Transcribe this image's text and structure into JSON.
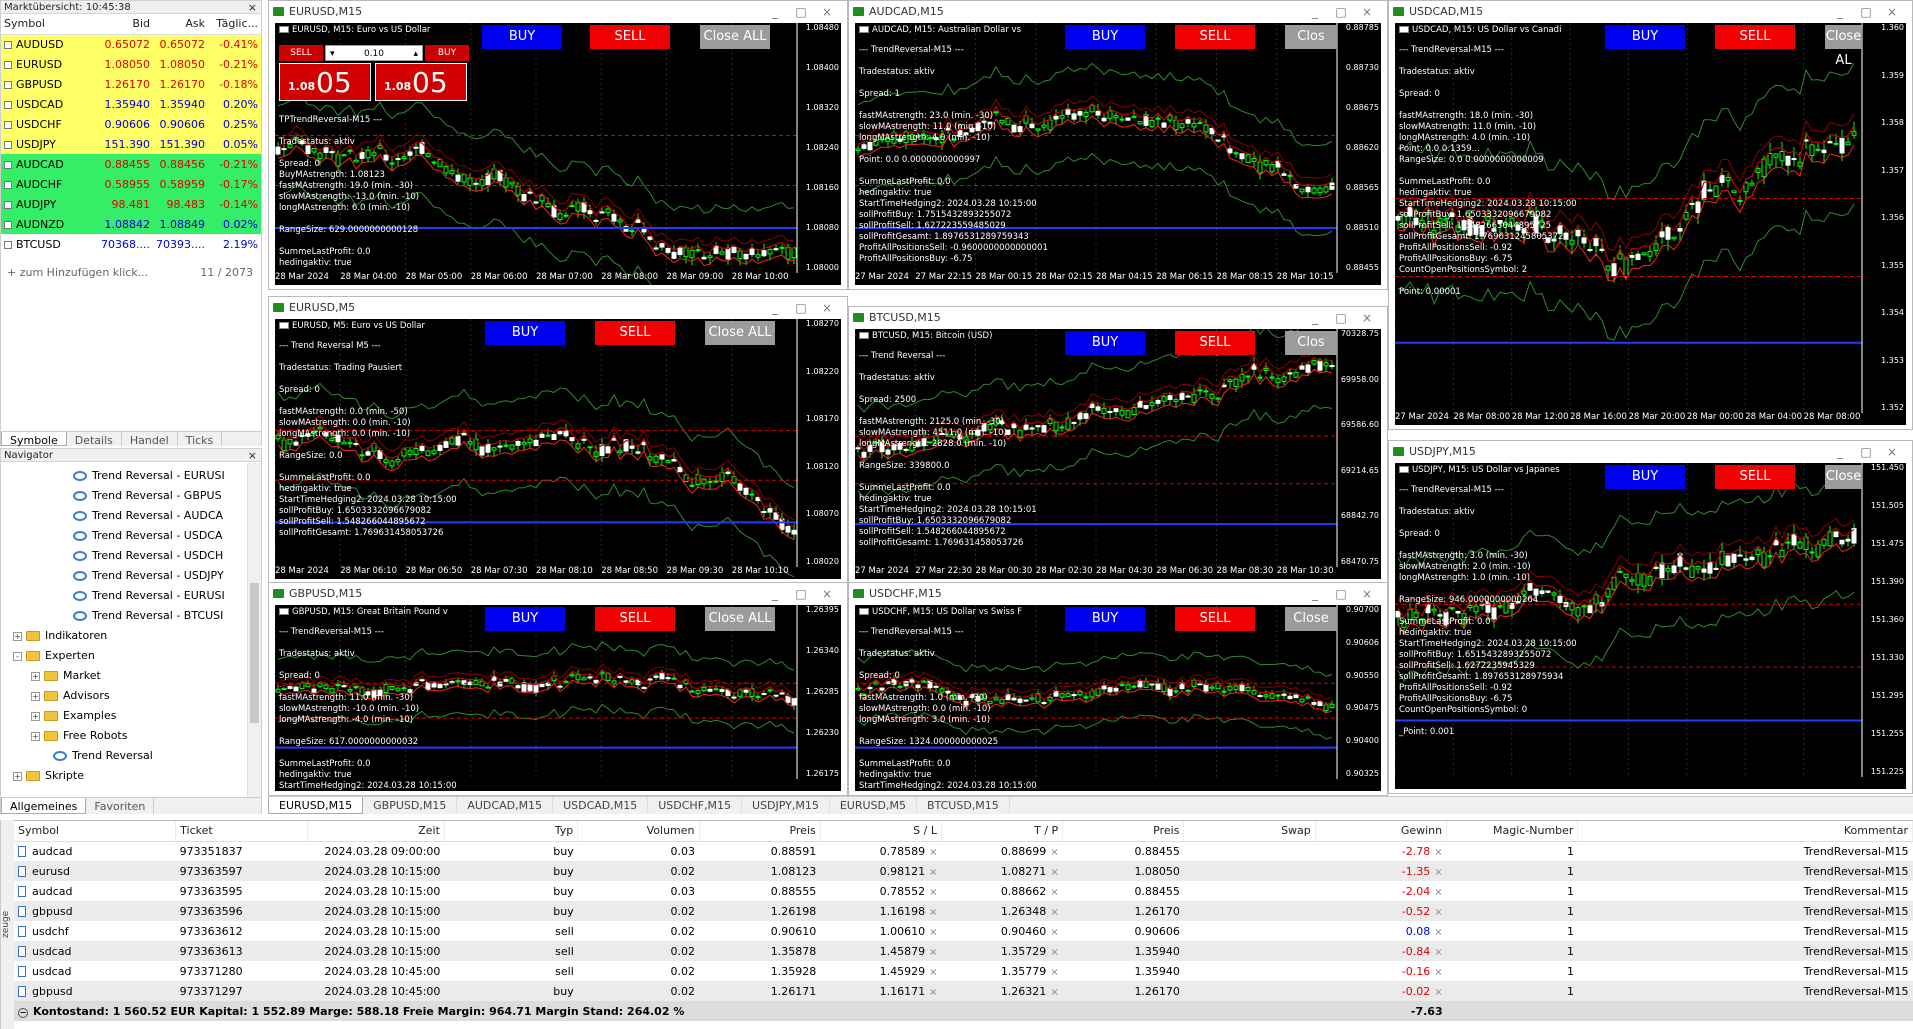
{
  "market_watch": {
    "title": "Marktübersicht: 10:45:38",
    "headers": {
      "symbol": "Symbol",
      "bid": "Bid",
      "ask": "Ask",
      "daily": "Täglic..."
    },
    "rows": [
      {
        "symbol": "AUDUSD",
        "bid": "0.65072",
        "ask": "0.65072",
        "change": "-0.41%",
        "color": "#ffff66",
        "change_color": "#e00000"
      },
      {
        "symbol": "EURUSD",
        "bid": "1.08050",
        "ask": "1.08050",
        "change": "-0.21%",
        "color": "#ffff66",
        "change_color": "#e00000"
      },
      {
        "symbol": "GBPUSD",
        "bid": "1.26170",
        "ask": "1.26170",
        "change": "-0.18%",
        "color": "#ffff66",
        "change_color": "#e00000"
      },
      {
        "symbol": "USDCAD",
        "bid": "1.35940",
        "ask": "1.35940",
        "change": "0.20%",
        "color": "#ffff66",
        "change_color": "#0000d0"
      },
      {
        "symbol": "USDCHF",
        "bid": "0.90606",
        "ask": "0.90606",
        "change": "0.25%",
        "color": "#ffff66",
        "change_color": "#0000d0"
      },
      {
        "symbol": "USDJPY",
        "bid": "151.390",
        "ask": "151.390",
        "change": "0.05%",
        "color": "#ffff66",
        "change_color": "#0000d0"
      },
      {
        "symbol": "AUDCAD",
        "bid": "0.88455",
        "ask": "0.88456",
        "change": "-0.21%",
        "color": "#33ee66",
        "change_color": "#e00000"
      },
      {
        "symbol": "AUDCHF",
        "bid": "0.58955",
        "ask": "0.58959",
        "change": "-0.17%",
        "color": "#33ee66",
        "change_color": "#e00000"
      },
      {
        "symbol": "AUDJPY",
        "bid": "98.481",
        "ask": "98.483",
        "change": "-0.14%",
        "color": "#33ee66",
        "change_color": "#e00000"
      },
      {
        "symbol": "AUDNZD",
        "bid": "1.08842",
        "ask": "1.08849",
        "change": "0.02%",
        "color": "#33ee66",
        "change_color": "#0000d0"
      },
      {
        "symbol": "BTCUSD",
        "bid": "70368....",
        "ask": "70393....",
        "change": "2.19%",
        "color": "#ffffff",
        "change_color": "#0000d0"
      }
    ],
    "add_label": "zum Hinzufügen klick...",
    "count": "11 / 2073",
    "tabs": [
      "Symbole",
      "Details",
      "Handel",
      "Ticks"
    ]
  },
  "navigator": {
    "title": "Navigator",
    "items": [
      {
        "label": "Trend Reversal - EURUSI",
        "type": "ea",
        "indent": 72
      },
      {
        "label": "Trend Reversal - GBPUS",
        "type": "ea",
        "indent": 72
      },
      {
        "label": "Trend Reversal - AUDCA",
        "type": "ea",
        "indent": 72
      },
      {
        "label": "Trend Reversal - USDCA",
        "type": "ea",
        "indent": 72
      },
      {
        "label": "Trend Reversal - USDCH",
        "type": "ea",
        "indent": 72
      },
      {
        "label": "Trend Reversal - USDJPY",
        "type": "ea",
        "indent": 72
      },
      {
        "label": "Trend Reversal - EURUSI",
        "type": "ea",
        "indent": 72
      },
      {
        "label": "Trend Reversal - BTCUSI",
        "type": "ea",
        "indent": 72
      },
      {
        "label": "Indikatoren",
        "type": "folder",
        "indent": 12,
        "expander": "+"
      },
      {
        "label": "Experten",
        "type": "folder",
        "indent": 12,
        "expander": "-"
      },
      {
        "label": "Market",
        "type": "folder",
        "indent": 30,
        "expander": "+"
      },
      {
        "label": "Advisors",
        "type": "folder",
        "indent": 30,
        "expander": "+"
      },
      {
        "label": "Examples",
        "type": "folder",
        "indent": 30,
        "expander": "+"
      },
      {
        "label": "Free Robots",
        "type": "folder",
        "indent": 30,
        "expander": "+"
      },
      {
        "label": "Trend Reversal",
        "type": "ea",
        "indent": 52
      },
      {
        "label": "Skripte",
        "type": "folder",
        "indent": 12,
        "expander": "+"
      }
    ],
    "tabs": [
      "Allgemeines",
      "Favoriten"
    ]
  },
  "charts": [
    {
      "id": "c1",
      "title": "EURUSD,M15",
      "info": "EURUSD, M15:  Euro vs US Dollar",
      "x": 268,
      "y": 0,
      "w": 580,
      "h": 290,
      "oneclick": true,
      "sell_price": "1.08",
      "sell_big": "05",
      "buy_price": "1.08",
      "buy_big": "05",
      "lot": "0.10",
      "sell_lbl": "SELL",
      "buy_lbl": "BUY",
      "btn_buy": "BUY",
      "btn_sell": "SELL",
      "btn_close": "Close ALL",
      "btnx": [
        475,
        583,
        693
      ],
      "text": "TPTrendReversal-M15 ---\n\nTradestatus: aktiv\n\nSpread: 0\nBuyMAstrength: 1.08123\nfastMAstrength: 19.0 (min. -30)\nslowMAstrength: -13.0 (min. -10)\nlongMAstrength: 6.0 (min. -10)\n\nRangeSize: 629.0000000000128\n\nSummeLastProfit: 0.0\nhedingaktiv: true",
      "yticks": [
        "1.08480",
        "1.08400",
        "1.08320",
        "1.08240",
        "1.08160",
        "1.08080",
        "1.08000"
      ],
      "xticks": [
        "28 Mar 2024",
        "28 Mar 04:00",
        "28 Mar 05:00",
        "28 Mar 06:00",
        "28 Mar 07:00",
        "28 Mar 08:00",
        "28 Mar 09:00",
        "28 Mar 10:00"
      ],
      "seed": 3,
      "trend": "down"
    },
    {
      "id": "c2",
      "title": "AUDCAD,M15",
      "info": "AUDCAD, M15:  Australian Dollar vs",
      "x": 848,
      "y": 0,
      "w": 540,
      "h": 290,
      "oneclick": false,
      "btn_buy": "BUY",
      "btn_sell": "SELL",
      "btn_close": "Clos",
      "btnx": [
        210,
        320,
        430
      ],
      "text": "--- TrendReversal-M15 ---\n\nTradestatus: aktiv\n\nSpread: 1\n\nfastMAstrength: 23.0 (min. -30)\nslowMAstrength: 11.0 (min. -10)\nlongMAstrength: 4.0 (min. -10)\n\nPoint: 0.0 0.0000000000997\n\nSummeLastProfit: 0.0\nhedingaktiv: true\nStartTimeHedging2: 2024.03.28 10:15:00\nsollProfitBuy: 1.7515432893255072\nsollProfitSell: 1.627223559485029\nsollProfitGesamt: 1.8976531289759343\nProfitAllPositionsSell: -0.9600000000000001\nProfitAllPositionsBuy: -6.75",
      "yticks": [
        "0.88785",
        "0.88730",
        "0.88675",
        "0.88620",
        "0.88565",
        "0.88510",
        "0.88455"
      ],
      "xticks": [
        "27 Mar 2024",
        "27 Mar 22:15",
        "28 Mar 00:15",
        "28 Mar 02:15",
        "28 Mar 04:15",
        "28 Mar 06:15",
        "28 Mar 08:15",
        "28 Mar 10:15"
      ],
      "seed": 7,
      "trend": "hump"
    },
    {
      "id": "c3",
      "title": "USDCAD,M15",
      "info": "USDCAD, M15:  US Dollar vs Canadi",
      "x": 1388,
      "y": 0,
      "w": 525,
      "h": 430,
      "oneclick": false,
      "btn_buy": "BUY",
      "btn_sell": "SELL",
      "btn_close": "Close AL",
      "btnx": [
        210,
        320,
        430
      ],
      "text": "--- TrendReversal-M15 ---\n\nTradestatus: aktiv\n\nSpread: 0\n\nfastMAstrength: 18.0 (min. -30)\nslowMAstrength: 11.0 (min. -10)\nlongMAstrength: 4.0 (min. -10)\nPoint: 0.0 0.1359...\nRangeSize: 0.0 0.0000000000009\n\nSummeLastProfit: 0.0\nhedingaktiv: true\nStartTimeHedging2: 2024.03.28 10:15:00\nsollProfitBuy: 1.6503332096679082\nsollProfitSell: 1.5482665044895725\nsollProfitGesamt: 1.7696312458053726\nProfitAllPositionsSell: -0.92\nProfitAllPositionsBuy: -6.75\nCountOpenPositionsSymbol: 2\n\nPoint: 0.00001",
      "yticks": [
        "1.360",
        "1.359",
        "1.358",
        "1.357",
        "1.356",
        "1.355",
        "1.354",
        "1.353",
        "1.352"
      ],
      "xticks": [
        "27 Mar 2024",
        "28 Mar 08:00",
        "28 Mar 12:00",
        "28 Mar 16:00",
        "28 Mar 20:00",
        "28 Mar 00:00",
        "28 Mar 04:00",
        "28 Mar 08:00"
      ],
      "seed": 11,
      "trend": "vee"
    },
    {
      "id": "c4",
      "title": "EURUSD,M5",
      "info": "EURUSD, M5:  Euro vs US Dollar",
      "x": 268,
      "y": 296,
      "w": 580,
      "h": 288,
      "oneclick": false,
      "btn_buy": "BUY",
      "btn_sell": "SELL",
      "btn_close": "Close ALL",
      "btnx": [
        210,
        320,
        430
      ],
      "text": "--- Trend Reversal M5 ---\n\nTradestatus: Trading Pausiert\n\nSpread: 0\n\nfastMAstrength: 0.0 (min. -50)\nslowMAstrength: 0.0 (min. -10)\nlongMAstrength: 0.0 (min. -10)\n\nRangeSize: 0.0\n\nSummeLastProfit: 0.0\nhedingaktiv: true\nStartTimeHedging2: 2024.03.28 10:15:00\nsollProfitBuy: 1.6503332096679082\nsollProfitSell: 1.548266044895672\nsollProfitGesamt: 1.769631458053726",
      "yticks": [
        "1.08270",
        "1.08220",
        "1.08170",
        "1.08120",
        "1.08070",
        "1.08020"
      ],
      "xticks": [
        "28 Mar 2024",
        "28 Mar 06:10",
        "28 Mar 06:50",
        "28 Mar 07:30",
        "28 Mar 08:10",
        "28 Mar 08:50",
        "28 Mar 09:30",
        "28 Mar 10:10"
      ],
      "seed": 5,
      "trend": "down"
    },
    {
      "id": "c5",
      "title": "BTCUSD,M15",
      "info": "BTCUSD, M15:  Bitcoin (USD)",
      "x": 848,
      "y": 306,
      "w": 540,
      "h": 278,
      "oneclick": false,
      "btn_buy": "BUY",
      "btn_sell": "SELL",
      "btn_close": "Clos",
      "btnx": [
        210,
        320,
        430
      ],
      "text": "--- Trend Reversal ---\n\nTradestatus: aktiv\n\nSpread: 2500\n\nfastMAstrength: 2125.0 (min. -30)\nslowMAstrength: 4511.0 (min. -10)\nlongMAstrength: 2828.0 (min. -10)\n\nRangeSize: 339800.0\n\nSummeLastProfit: 0.0\nhedingaktiv: true\nStartTimeHedging2: 2024.03.28 10:15:01\nsollProfitBuy: 1.6503332096679082\nsollProfitSell: 1.548266044895672\nsollProfitGesamt: 1.769631458053726",
      "yticks": [
        "70328.75",
        "69958.00",
        "69586.60",
        "69214.65",
        "68842.70",
        "68470.75"
      ],
      "xticks": [
        "27 Mar 2024",
        "27 Mar 22:30",
        "28 Mar 00:30",
        "28 Mar 02:30",
        "28 Mar 04:30",
        "28 Mar 06:30",
        "28 Mar 08:30",
        "28 Mar 10:30"
      ],
      "seed": 9,
      "trend": "up"
    },
    {
      "id": "c6",
      "title": "USDJPY,M15",
      "info": "USDJPY, M15:  US Dollar vs Japanes",
      "x": 1388,
      "y": 440,
      "w": 525,
      "h": 354,
      "oneclick": false,
      "btn_buy": "BUY",
      "btn_sell": "SELL",
      "btn_close": "Close",
      "btnx": [
        210,
        320,
        430
      ],
      "text": "--- TrendReversal-M15 ---\n\nTradestatus: aktiv\n\nSpread: 0\n\nfastMAstrength: 3.0 (min. -30)\nslowMAstrength: 2.0 (min. -10)\nlongMAstrength: 1.0 (min. -10)\n\nRangeSize: 946.0000000000264\n\nSummeLastProfit: 0.0\nhedingaktiv: true\nStartTimeHedging2: 2024.03.28 10:15:00\nsollProfitBuy: 1.6515432893255072\nsollProfitSell: 1.6272235945329\nsollProfitGesamt: 1.897653128975934\nProfitAllPositionsSell: -0.92\nProfitAllPositionsBuy: -6.75\nCountOpenPositionsSymbol: 0\n\n_Point: 0.001",
      "yticks": [
        "151.450",
        "151.505",
        "151.475",
        "151.390",
        "151.360",
        "151.330",
        "151.295",
        "151.255",
        "151.225"
      ],
      "xticks": [],
      "seed": 13,
      "trend": "up"
    },
    {
      "id": "c7",
      "title": "GBPUSD,M15",
      "info": "GBPUSD, M15:  Great Britain Pound v",
      "x": 268,
      "y": 582,
      "w": 580,
      "h": 214,
      "oneclick": false,
      "btn_buy": "BUY",
      "btn_sell": "SELL",
      "btn_close": "Close ALL",
      "btnx": [
        210,
        320,
        430
      ],
      "text": "--- TrendReversal-M15 ---\n\nTradestatus: aktiv\n\nSpread: 0\n\nfastMAstrength: 11.0 (min. -30)\nslowMAstrength: -10.0 (min. -10)\nlongMAstrength: -4.0 (min. -10)\n\nRangeSize: 617.0000000000032\n\nSummeLastProfit: 0.0\nhedingaktiv: true\nStartTimeHedging2: 2024.03.28 10:15:00",
      "yticks": [
        "1.26395",
        "1.26340",
        "1.26285",
        "1.26230",
        "1.26175"
      ],
      "xticks": [],
      "seed": 17,
      "trend": "flat"
    },
    {
      "id": "c8",
      "title": "USDCHF,M15",
      "info": "USDCHF, M15:  US Dollar vs Swiss F",
      "x": 848,
      "y": 582,
      "w": 540,
      "h": 214,
      "oneclick": false,
      "btn_buy": "BUY",
      "btn_sell": "SELL",
      "btn_close": "Close",
      "btnx": [
        210,
        320,
        430
      ],
      "text": "--- TrendReversal-M15 ---\n\nTradestatus: aktiv\n\nSpread: 0\n\nfastMAstrength: 1.0 (min. -30)\nslowMAstrength: 0.0 (min. -10)\nlongMAstrength: 3.0 (min. -10)\n\nRangeSize: 1324.000000000025\n\nSummeLastProfit: 0.0\nhedingaktiv: true\nStartTimeHedging2: 2024.03.28 10:15:00",
      "yticks": [
        "0.90700",
        "0.90606",
        "0.90550",
        "0.90475",
        "0.90400",
        "0.90325"
      ],
      "xticks": [],
      "seed": 19,
      "trend": "flat"
    }
  ],
  "chart_tabs": [
    "EURUSD,M15",
    "GBPUSD,M15",
    "AUDCAD,M15",
    "USDCAD,M15",
    "USDCHF,M15",
    "USDJPY,M15",
    "EURUSD,M5",
    "BTCUSD,M15"
  ],
  "terminal": {
    "headers": [
      "Symbol",
      "Ticket",
      "Zeit",
      "Typ",
      "Volumen",
      "Preis",
      "S / L",
      "T / P",
      "Preis",
      "Swap",
      "Gewinn",
      "Magic-Number",
      "Kommentar"
    ],
    "rows": [
      [
        "audcad",
        "973351837",
        "2024.03.28 09:00:00",
        "buy",
        "0.03",
        "0.88591",
        "0.78589",
        "0.88699",
        "0.88455",
        "",
        "-2.78",
        "1",
        "TrendReversal-M15"
      ],
      [
        "eurusd",
        "973363597",
        "2024.03.28 10:15:00",
        "buy",
        "0.02",
        "1.08123",
        "0.98121",
        "1.08271",
        "1.08050",
        "",
        "-1.35",
        "1",
        "TrendReversal-M15"
      ],
      [
        "audcad",
        "973363595",
        "2024.03.28 10:15:00",
        "buy",
        "0.03",
        "0.88555",
        "0.78552",
        "0.88662",
        "0.88455",
        "",
        "-2.04",
        "1",
        "TrendReversal-M15"
      ],
      [
        "gbpusd",
        "973363596",
        "2024.03.28 10:15:00",
        "buy",
        "0.02",
        "1.26198",
        "1.16198",
        "1.26348",
        "1.26170",
        "",
        "-0.52",
        "1",
        "TrendReversal-M15"
      ],
      [
        "usdchf",
        "973363612",
        "2024.03.28 10:15:00",
        "sell",
        "0.02",
        "0.90610",
        "1.00610",
        "0.90460",
        "0.90606",
        "",
        "0.08",
        "1",
        "TrendReversal-M15"
      ],
      [
        "usdcad",
        "973363613",
        "2024.03.28 10:15:00",
        "sell",
        "0.02",
        "1.35878",
        "1.45879",
        "1.35729",
        "1.35940",
        "",
        "-0.84",
        "1",
        "TrendReversal-M15"
      ],
      [
        "usdcad",
        "973371280",
        "2024.03.28 10:45:00",
        "sell",
        "0.02",
        "1.35928",
        "1.45929",
        "1.35779",
        "1.35940",
        "",
        "-0.16",
        "1",
        "TrendReversal-M15"
      ],
      [
        "gbpusd",
        "973371297",
        "2024.03.28 10:45:00",
        "buy",
        "0.02",
        "1.26171",
        "1.16171",
        "1.26321",
        "1.26170",
        "",
        "-0.02",
        "1",
        "TrendReversal-M15"
      ]
    ],
    "summary": "Kontostand: 1 560.52 EUR  Kapital: 1 552.89  Marge: 588.18  Freie Margin: 964.71  Margin Stand: 264.02 %",
    "total": "-7.63",
    "side_label": "zeuge"
  }
}
